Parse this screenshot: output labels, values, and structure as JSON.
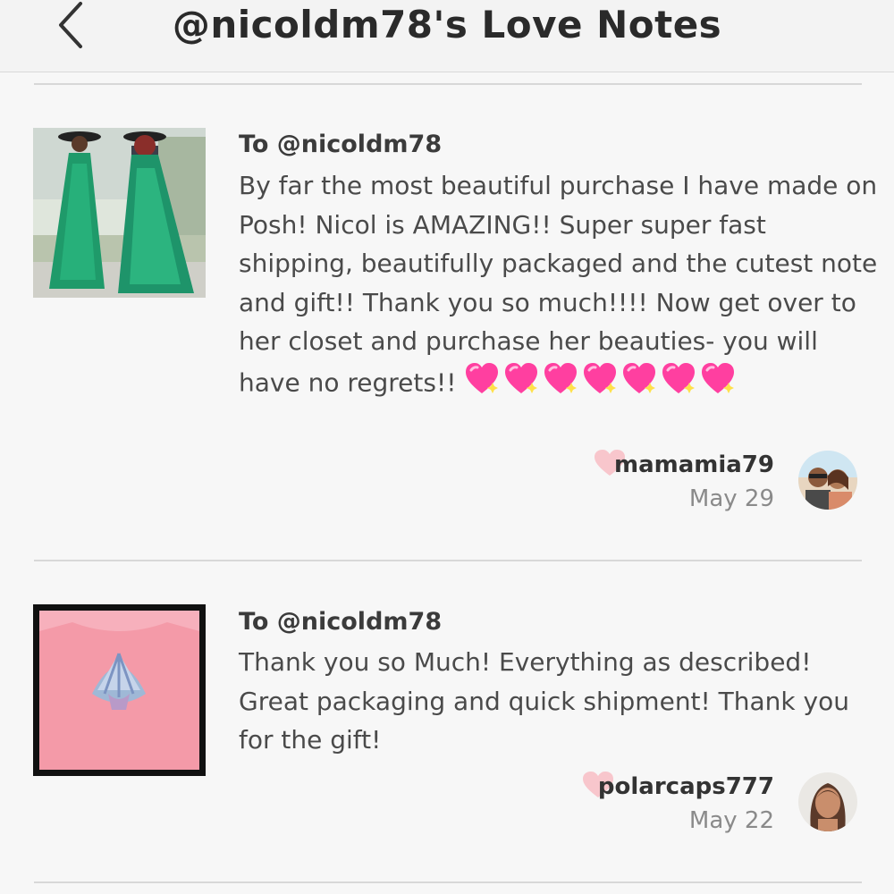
{
  "header": {
    "title": "@nicoldm78's Love Notes",
    "back_icon": "chevron-left-icon"
  },
  "notes": [
    {
      "to": "To @nicoldm78",
      "message": "By far the most beautiful purchase I have made on Posh! Nicol is AMAZING!! Super super fast shipping, beautifully packaged and the cutest note and gift!! Thank you so much!!!! Now get over to her closet and purchase her beauties- you will have no regrets!!",
      "emoji": "sparkling-heart-icon",
      "emoji_count": 7,
      "username": "mamamia79",
      "date": "May 29",
      "thumbnail": "green-dress-photo"
    },
    {
      "to": "To @nicoldm78",
      "message": "Thank you so Much! Everything as described! Great packaging and quick shipment! Thank you for the gift!",
      "username": "polarcaps777",
      "date": "May 22",
      "thumbnail": "pink-shell-shirt-photo"
    }
  ],
  "colors": {
    "heart": "#f8c6cc",
    "emoji_heart": "#ff3fa0",
    "text": "#4a4a4a",
    "date": "#8a8a8a"
  }
}
